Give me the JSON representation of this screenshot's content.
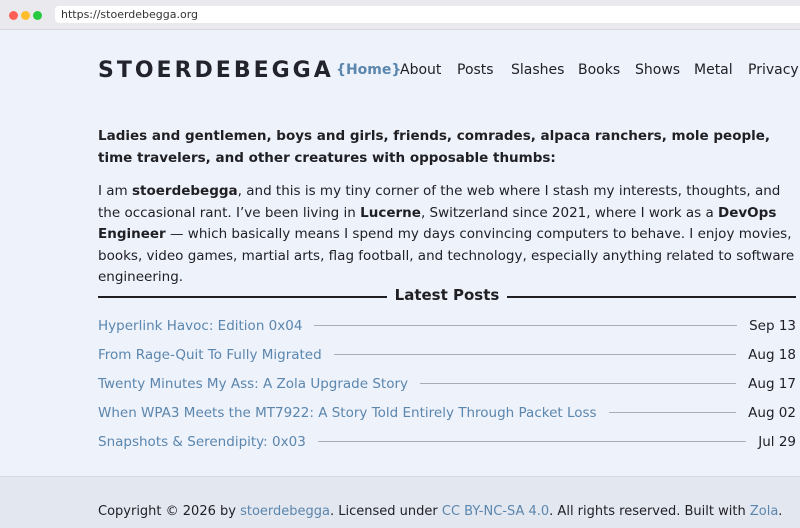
{
  "browser": {
    "url": "https://stoerdebegga.org"
  },
  "header": {
    "site_title": "STOERDEBEGGA",
    "nav": [
      "{Home}",
      "About",
      "Posts",
      "Slashes",
      "Books",
      "Shows",
      "Metal",
      "Privacy"
    ]
  },
  "intro": {
    "lead": "Ladies and gentlemen, boys and girls, friends, comrades, alpaca ranchers, mole people, time travelers, and other creatures with opposable thumbs:",
    "p1": "I am ",
    "name": "stoerdebegga",
    "p2": ", and this is my tiny corner of the web where I stash my interests, thoughts, and the occasional rant. I’ve been living in ",
    "city": "Lucerne",
    "p3": ", Switzerland since 2021, where I work as a ",
    "role": "DevOps Engineer",
    "p4": " — which basically means I spend my days convincing computers to behave. I enjoy movies, books, video games, martial arts, flag football, and technology, especially anything related to software engineering."
  },
  "latest": {
    "heading": "Latest Posts",
    "posts": [
      {
        "title": "Hyperlink Havoc: Edition 0x04",
        "date": "Sep 13"
      },
      {
        "title": "From Rage-Quit To Fully Migrated",
        "date": "Aug 18"
      },
      {
        "title": "Twenty Minutes My Ass: A Zola Upgrade Story",
        "date": "Aug 17"
      },
      {
        "title": "When WPA3 Meets the MT7922: A Story Told Entirely Through Packet Loss",
        "date": "Aug 02"
      },
      {
        "title": "Snapshots & Serendipity: 0x03",
        "date": "Jul 29"
      }
    ]
  },
  "footer": {
    "t1": "Copyright © 2026 by ",
    "author_link": "stoerdebegga",
    "t2": ". Licensed under ",
    "license_link": "CC BY-NC-SA 4.0",
    "t3": ". All rights reserved. Built with ",
    "zola_link": "Zola",
    "t4": "."
  },
  "colors": {
    "accent": "#5b86ad",
    "background": "#eef2fb",
    "text": "#1f1f24"
  }
}
